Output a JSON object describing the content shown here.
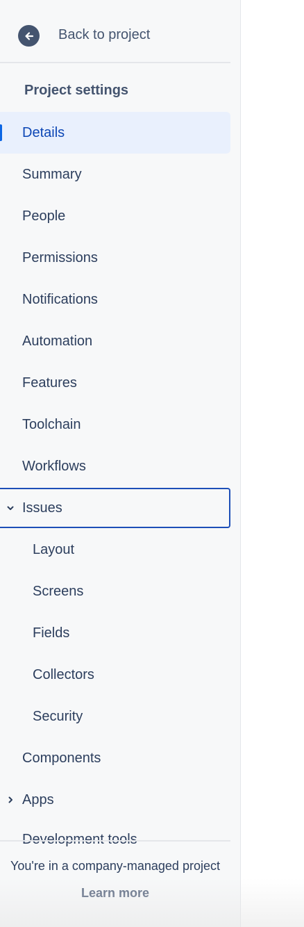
{
  "back": {
    "label": "Back to project",
    "icon": "arrow-left-icon"
  },
  "sidebar": {
    "section_title": "Project settings",
    "items": [
      {
        "label": "Details"
      },
      {
        "label": "Summary"
      },
      {
        "label": "People"
      },
      {
        "label": "Permissions"
      },
      {
        "label": "Notifications"
      },
      {
        "label": "Automation"
      },
      {
        "label": "Features"
      },
      {
        "label": "Toolchain"
      },
      {
        "label": "Workflows"
      },
      {
        "label": "Issues"
      },
      {
        "label": "Layout"
      },
      {
        "label": "Screens"
      },
      {
        "label": "Fields"
      },
      {
        "label": "Collectors"
      },
      {
        "label": "Security"
      },
      {
        "label": "Components"
      },
      {
        "label": "Apps"
      },
      {
        "label": "Development tools"
      }
    ]
  },
  "footer": {
    "text": "You're in a company-managed project",
    "link": "Learn more"
  },
  "colors": {
    "accent": "#0c66e4",
    "selected_bg": "#e9f0fd",
    "focus_border": "#1d4fb8",
    "text": "#2c3e5d"
  }
}
